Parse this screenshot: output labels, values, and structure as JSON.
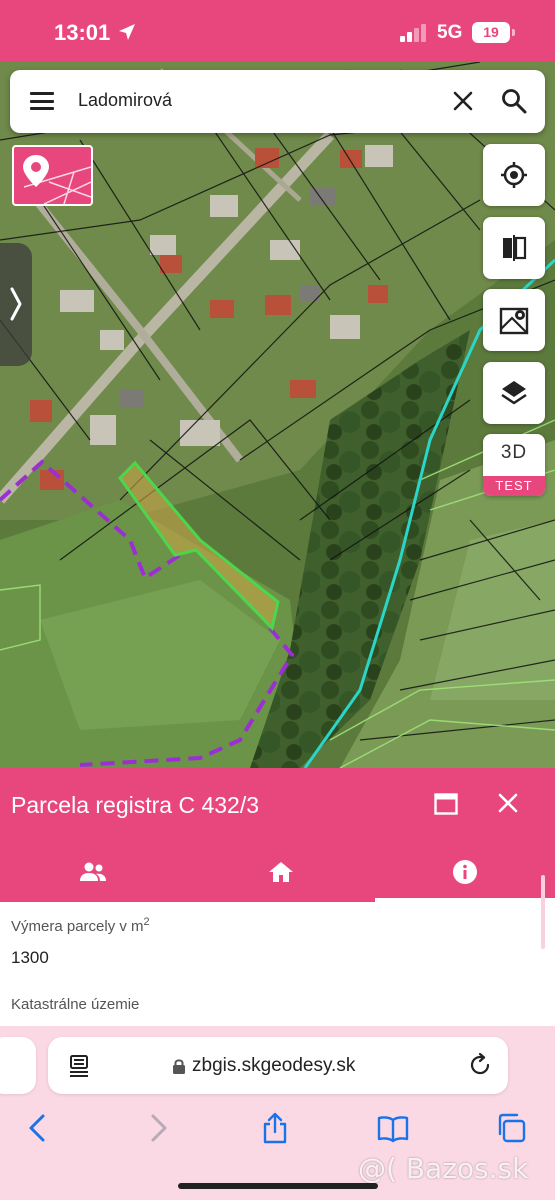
{
  "status_bar": {
    "time": "13:01",
    "network": "5G",
    "battery": "19"
  },
  "search": {
    "query": "Ladomirová"
  },
  "map_controls": {
    "btn_3d_label": "3D",
    "btn_3d_badge": "TEST"
  },
  "panel": {
    "title": "Parcela registra C 432/3",
    "tabs": [
      "owners-tab",
      "home-tab",
      "info-tab"
    ],
    "fields": {
      "area_label_prefix": "Výmera parcely v m",
      "area_label_sup": "2",
      "area_value": "1300",
      "cadastral_label": "Katastrálne územie"
    }
  },
  "browser": {
    "url": "zbgis.skgeodesy.sk"
  },
  "watermark": "@( Bazos.sk",
  "colors": {
    "accent": "#e8477e",
    "parcel_outline": "#4cd64c",
    "parcel_fill": "#c8a34a",
    "purple_boundary": "#9b2fd3",
    "cyan_line": "#2bd6c8"
  }
}
